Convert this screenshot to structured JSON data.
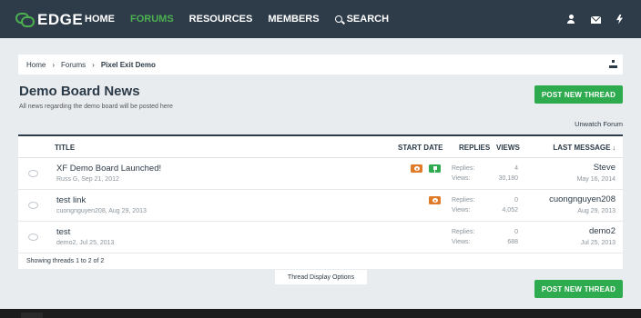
{
  "header": {
    "logo_text": "EDGE",
    "nav": [
      {
        "label": "HOME",
        "active": false
      },
      {
        "label": "FORUMS",
        "active": true
      },
      {
        "label": "RESOURCES",
        "active": false
      },
      {
        "label": "MEMBERS",
        "active": false
      },
      {
        "label": "SEARCH",
        "active": false
      }
    ],
    "icons": [
      "user-icon",
      "mail-icon",
      "alerts-bolt-icon"
    ]
  },
  "breadcrumb": {
    "items": [
      "Home",
      "Forums",
      "Pixel Exit Demo"
    ],
    "sitemap_icon": "sitemap-icon"
  },
  "forum": {
    "title": "Demo Board News",
    "description": "All news regarding the demo board will be posted here",
    "post_button": "POST NEW THREAD",
    "unwatch": "Unwatch Forum"
  },
  "table": {
    "columns": {
      "title": "TITLE",
      "start_date": "START DATE",
      "replies": "REPLIES",
      "views": "VIEWS",
      "last_message": "LAST MESSAGE",
      "sort_arrow": "↓"
    },
    "stat_labels": {
      "replies": "Replies:",
      "views": "Views:"
    },
    "rows": [
      {
        "title": "XF Demo Board Launched!",
        "meta": "Russ G, Sep 21, 2012",
        "replies": "4",
        "views": "30,180",
        "last_user": "Steve",
        "last_date": "May 16, 2014",
        "badges": [
          "watched",
          "sticky"
        ]
      },
      {
        "title": "test link",
        "meta": "cuongnguyen208, Aug 29, 2013",
        "replies": "0",
        "views": "4,052",
        "last_user": "cuongnguyen208",
        "last_date": "Aug 29, 2013",
        "badges": [
          "watched"
        ]
      },
      {
        "title": "test",
        "meta": "demo2, Jul 25, 2013",
        "replies": "0",
        "views": "688",
        "last_user": "demo2",
        "last_date": "Jul 25, 2013",
        "badges": []
      }
    ],
    "footer": "Showing threads 1 to 2 of 2"
  },
  "display_options": "Thread Display Options",
  "colors": {
    "header_bg": "#2e3c4a",
    "accent_green": "#2eaa4f",
    "watch_orange": "#e07b2a",
    "page_bg": "#e9ecef"
  }
}
